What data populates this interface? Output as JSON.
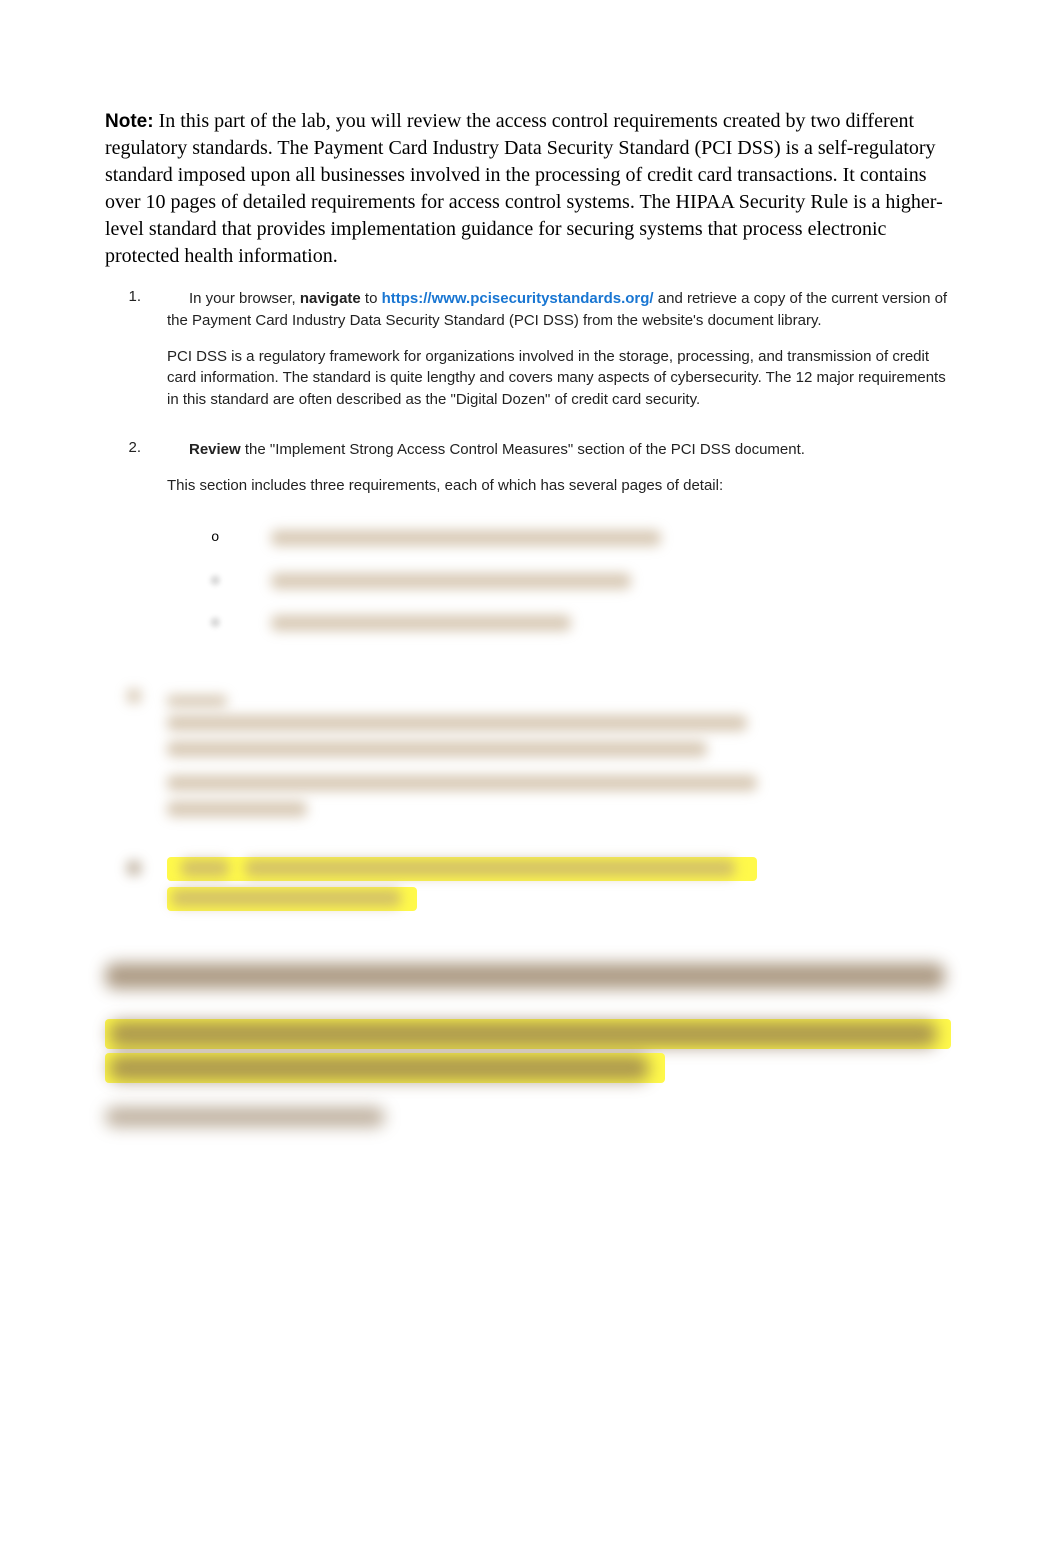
{
  "note_label": "Note:",
  "note_text": " In this part of the lab, you will review the access control requirements created by two different regulatory standards. The Payment Card Industry Data Security Standard (PCI DSS) is a self-regulatory standard imposed upon all businesses involved in the processing of credit card transactions. It contains over 10 pages of detailed requirements for access control systems. The HIPAA Security Rule is a higher-level standard that provides implementation guidance for securing systems that process electronic protected health information.",
  "steps": [
    {
      "num": "1.",
      "prefix": "In your browser, ",
      "bold1": "navigate",
      "mid1": " to ",
      "link": "https://www.pcisecuritystandards.org/",
      "after_link": " and retrieve a copy of the current version of the Payment Card Industry Data Security Standard (PCI DSS) from the website's document library.",
      "sub": "PCI DSS is a regulatory framework for organizations involved in the storage, processing, and transmission of credit card information. The standard is quite lengthy and covers many aspects of cybersecurity. The 12 major requirements in this standard are often described as the \"Digital Dozen\" of credit card security."
    },
    {
      "num": "2.",
      "bold1": "Review",
      "after_bold": " the \"Implement Strong Access Control Measures\" section of the PCI DSS document.",
      "sub": "This section includes three requirements, each of which has several pages of detail:"
    }
  ],
  "bullet_marker": "o"
}
